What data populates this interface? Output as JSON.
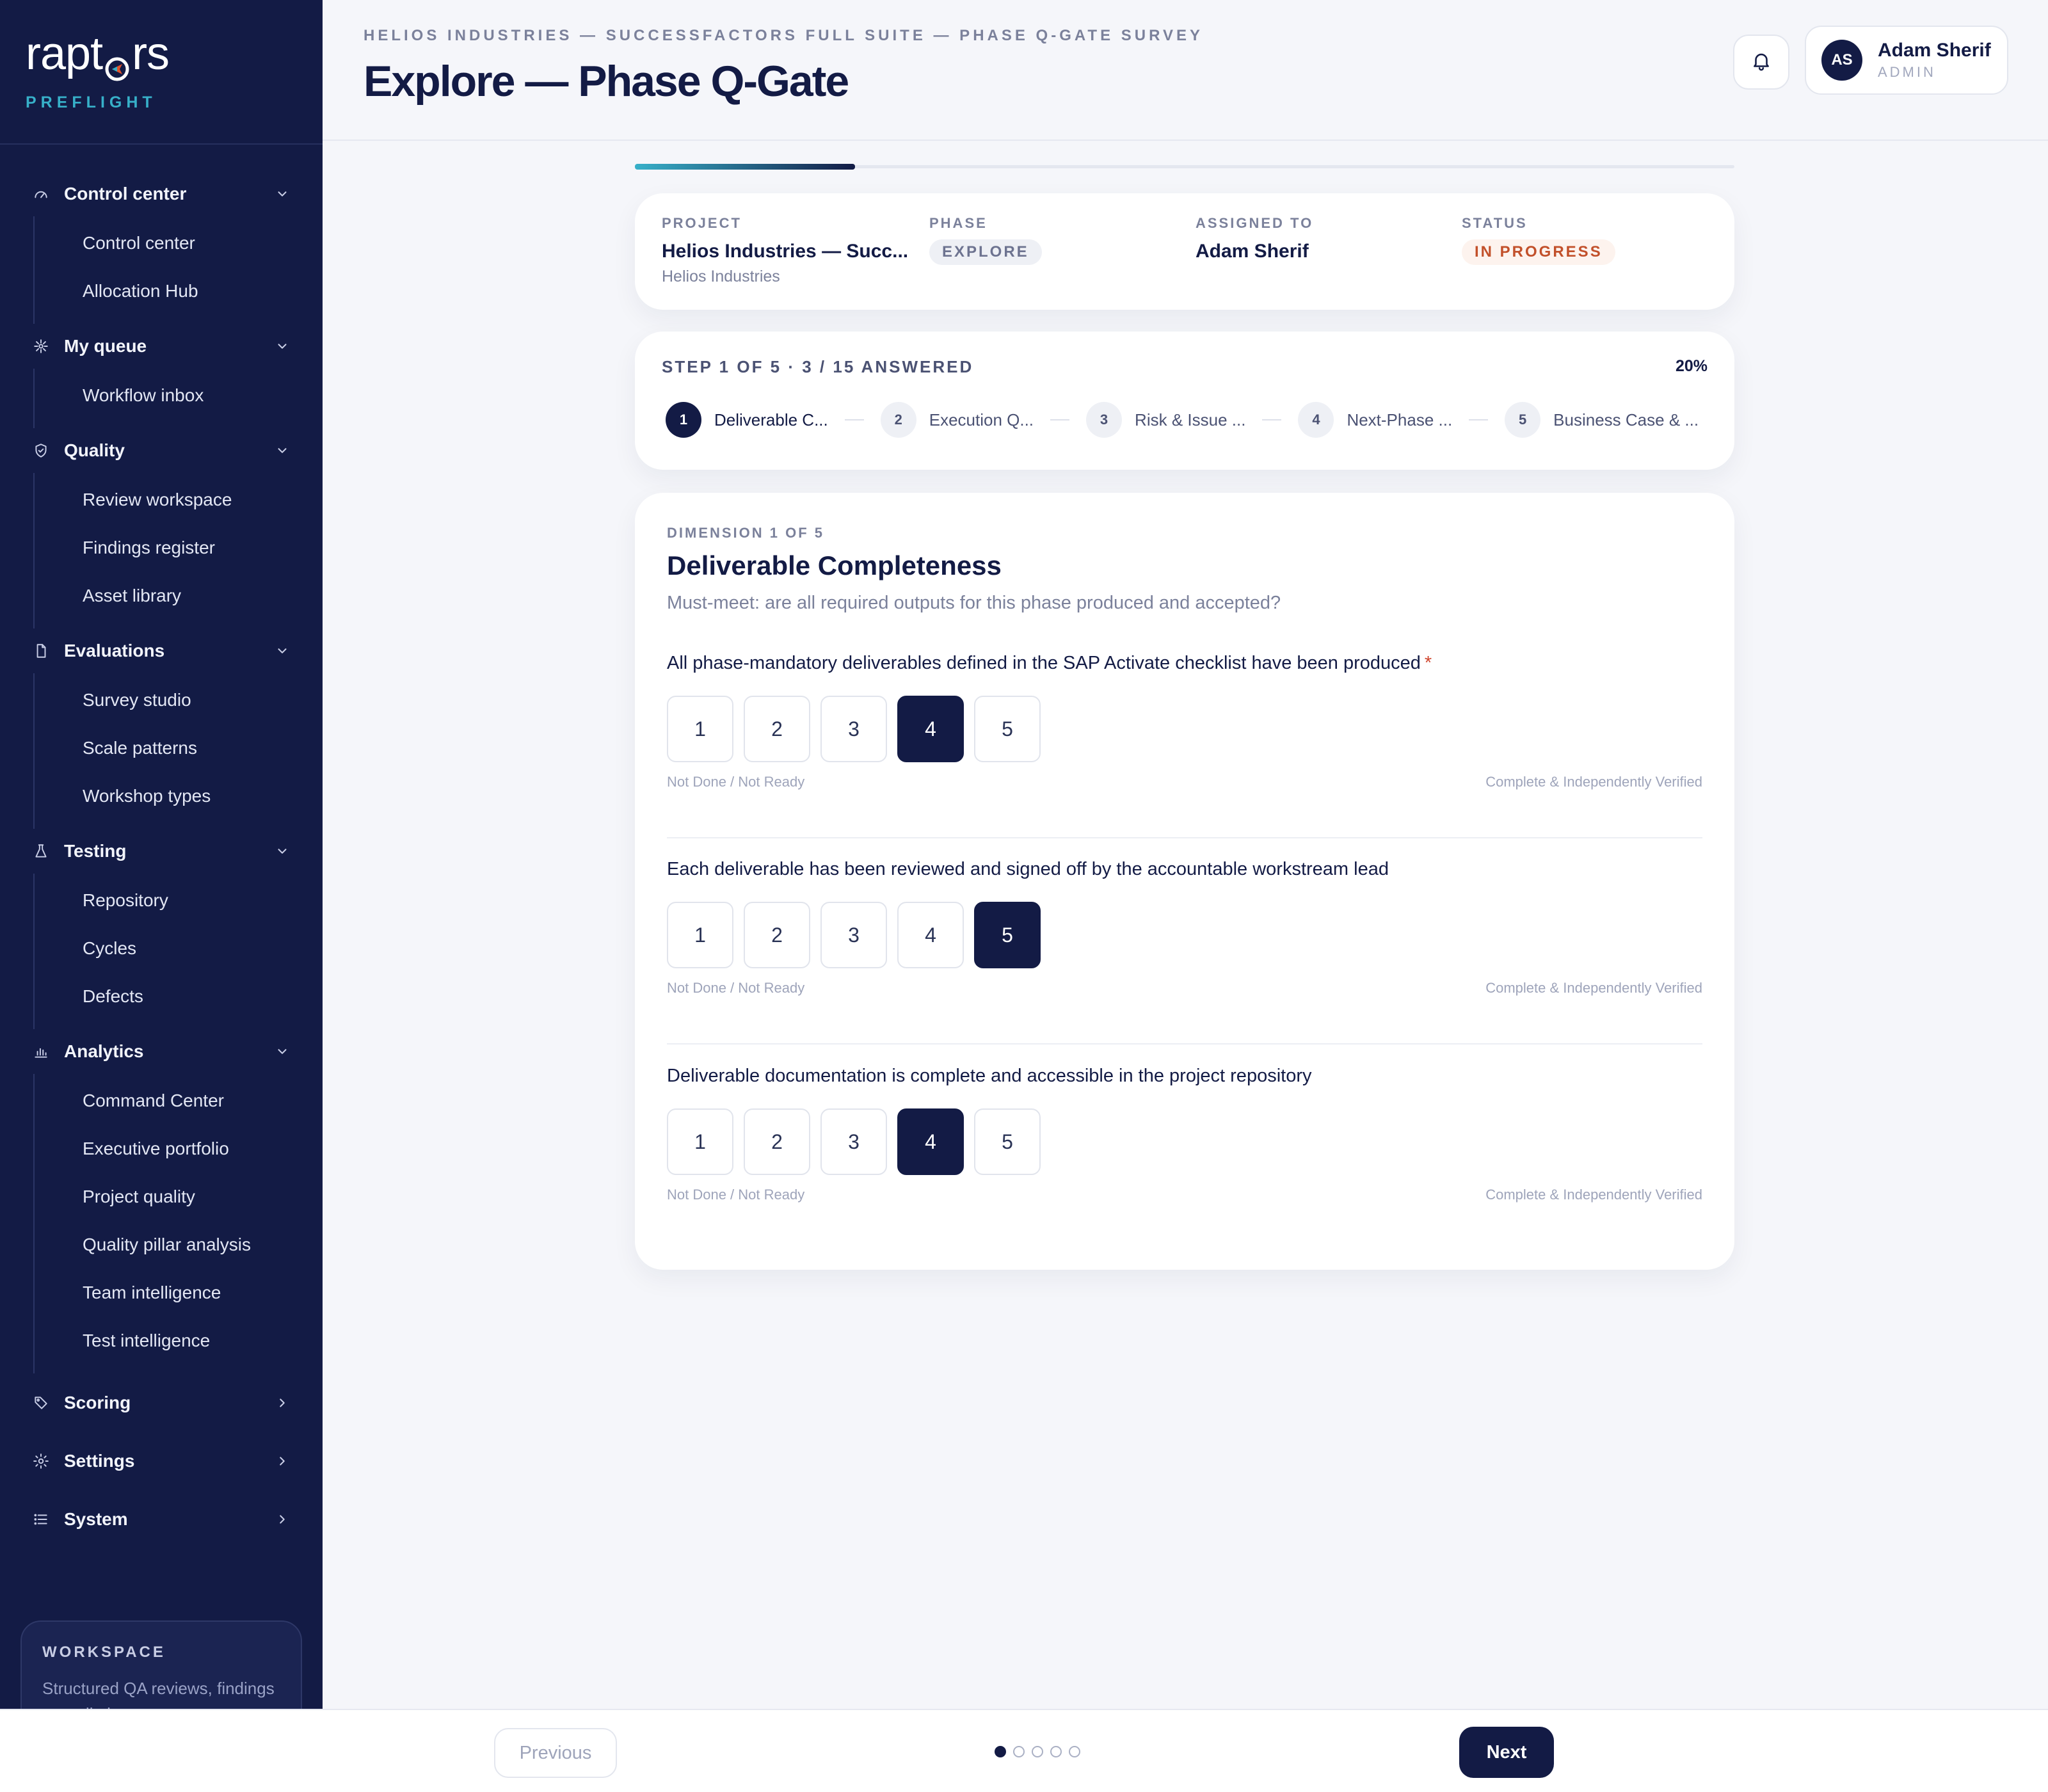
{
  "brand": {
    "logo_text_left": "rapt",
    "logo_text_right": "rs",
    "product": "PREFLIGHT"
  },
  "sidebar": {
    "groups": [
      {
        "label": "Control center",
        "icon": "gauge-icon",
        "expanded": true,
        "items": [
          {
            "label": "Control center"
          },
          {
            "label": "Allocation Hub"
          }
        ]
      },
      {
        "label": "My queue",
        "icon": "sparkle-icon",
        "expanded": true,
        "items": [
          {
            "label": "Workflow inbox"
          }
        ]
      },
      {
        "label": "Quality",
        "icon": "shield-icon",
        "expanded": true,
        "items": [
          {
            "label": "Review workspace"
          },
          {
            "label": "Findings register"
          },
          {
            "label": "Asset library"
          }
        ]
      },
      {
        "label": "Evaluations",
        "icon": "file-icon",
        "expanded": true,
        "items": [
          {
            "label": "Survey studio"
          },
          {
            "label": "Scale patterns"
          },
          {
            "label": "Workshop types"
          }
        ]
      },
      {
        "label": "Testing",
        "icon": "flask-icon",
        "expanded": true,
        "items": [
          {
            "label": "Repository"
          },
          {
            "label": "Cycles"
          },
          {
            "label": "Defects"
          }
        ]
      },
      {
        "label": "Analytics",
        "icon": "bar-chart-icon",
        "expanded": true,
        "items": [
          {
            "label": "Command Center"
          },
          {
            "label": "Executive portfolio"
          },
          {
            "label": "Project quality"
          },
          {
            "label": "Quality pillar analysis"
          },
          {
            "label": "Team intelligence"
          },
          {
            "label": "Test intelligence"
          }
        ]
      },
      {
        "label": "Scoring",
        "icon": "tag-icon",
        "expanded": false,
        "items": []
      },
      {
        "label": "Settings",
        "icon": "gear-icon",
        "expanded": false,
        "items": []
      },
      {
        "label": "System",
        "icon": "list-icon",
        "expanded": false,
        "items": []
      }
    ],
    "workspace": {
      "title": "WORKSPACE",
      "text": "Structured QA reviews, findings remediation"
    }
  },
  "header": {
    "breadcrumb": "HELIOS INDUSTRIES — SUCCESSFACTORS FULL SUITE — PHASE Q-GATE SURVEY",
    "title": "Explore — Phase Q-Gate",
    "user": {
      "initials": "AS",
      "name": "Adam Sherif",
      "role": "ADMIN"
    }
  },
  "progress": {
    "fraction": 0.2
  },
  "meta": {
    "project_label": "PROJECT",
    "project_value": "Helios Industries — Succ...",
    "project_sub": "Helios Industries",
    "phase_label": "PHASE",
    "phase_value": "EXPLORE",
    "assigned_label": "ASSIGNED TO",
    "assigned_value": "Adam Sherif",
    "status_label": "STATUS",
    "status_value": "IN PROGRESS"
  },
  "steps": {
    "summary": "STEP 1 OF 5 · 3 / 15 ANSWERED",
    "percent": "20%",
    "items": [
      {
        "num": "1",
        "label": "Deliverable C...",
        "active": true
      },
      {
        "num": "2",
        "label": "Execution Q...",
        "active": false
      },
      {
        "num": "3",
        "label": "Risk & Issue ...",
        "active": false
      },
      {
        "num": "4",
        "label": "Next-Phase ...",
        "active": false
      },
      {
        "num": "5",
        "label": "Business Case & ...",
        "active": false
      }
    ]
  },
  "dimension": {
    "eyebrow": "DIMENSION 1 OF 5",
    "title": "Deliverable Completeness",
    "description": "Must-meet: are all required outputs for this phase produced and accepted?",
    "scale_low": "Not Done / Not Ready",
    "scale_high": "Complete & Independently Verified",
    "questions": [
      {
        "text": "All phase-mandatory deliverables defined in the SAP Activate checklist have been produced",
        "required": "*",
        "selected": 4
      },
      {
        "text": "Each deliverable has been reviewed and signed off by the accountable workstream lead",
        "required": "",
        "selected": 5
      },
      {
        "text": "Deliverable documentation is complete and accessible in the project repository",
        "required": "",
        "selected": 4
      }
    ],
    "options": [
      "1",
      "2",
      "3",
      "4",
      "5"
    ]
  },
  "footer": {
    "previous_label": "Previous",
    "next_label": "Next",
    "page_count": 5,
    "current_page": 1
  },
  "colors": {
    "navy": "#131b45",
    "teal": "#37b0c9",
    "status": "#c2502a"
  }
}
